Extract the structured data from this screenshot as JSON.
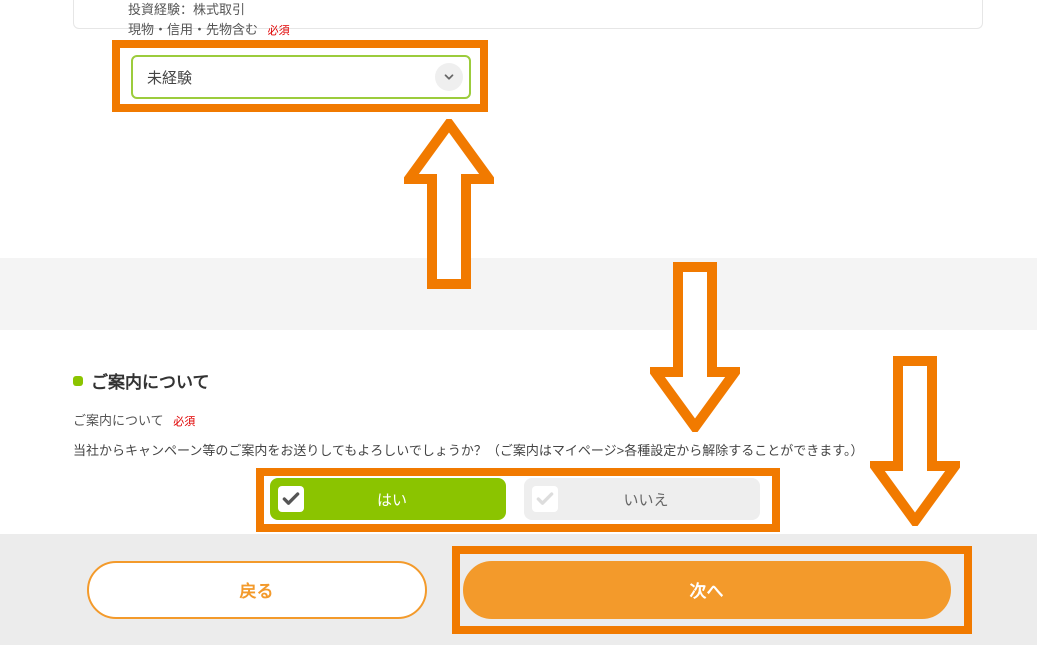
{
  "form": {
    "experience_label_line1": "投資経験：株式取引",
    "experience_label_line2": "現物・信用・先物含む",
    "required_badge": "必須",
    "dropdown_value": "未経験"
  },
  "info_section": {
    "heading": "ご案内について",
    "sub_label": "ご案内について",
    "description": "当社からキャンペーン等のご案内をお送りしてもよろしいでしょうか？（ご案内はマイページ>各種設定から解除することができます。）",
    "yes_label": "はい",
    "no_label": "いいえ"
  },
  "footer": {
    "back_label": "戻る",
    "next_label": "次へ"
  },
  "colors": {
    "accent_green": "#8bc400",
    "accent_orange": "#f39a2b",
    "highlight_orange": "#f17a00"
  }
}
